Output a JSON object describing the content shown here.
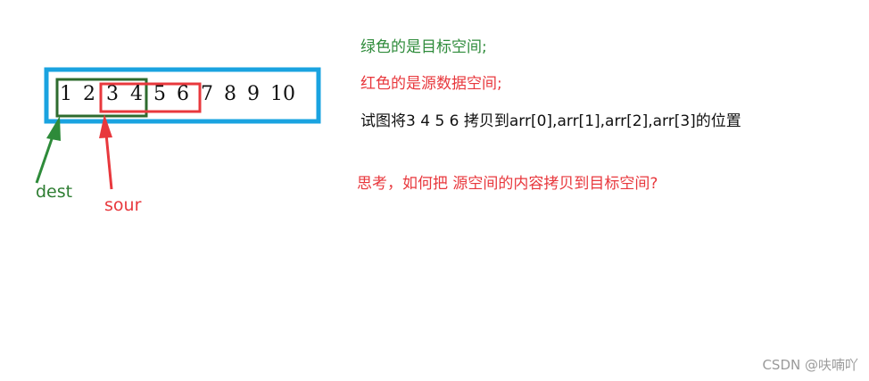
{
  "array": {
    "numbers": [
      "1",
      "2",
      "3",
      "4",
      "5",
      "6",
      "7",
      "8",
      "9",
      "10"
    ]
  },
  "pointers": {
    "dest_label": "dest",
    "sour_label": "sour"
  },
  "notes": {
    "green_line": "绿色的是目标空间;",
    "red_line": "红色的是源数据空间;",
    "black_line": "试图将3 4 5 6 拷贝到arr[0],arr[1],arr[2],arr[3]的位置",
    "question_line": "思考，如何把 源空间的内容拷贝到目标空间?"
  },
  "watermark": "CSDN @呋喃吖",
  "colors": {
    "outer_box": "#1aa3e0",
    "dest_box": "#2e6b2e",
    "sour_box": "#e8383d",
    "dest_arrow": "#2e8b3a",
    "sour_arrow": "#e8383d"
  }
}
